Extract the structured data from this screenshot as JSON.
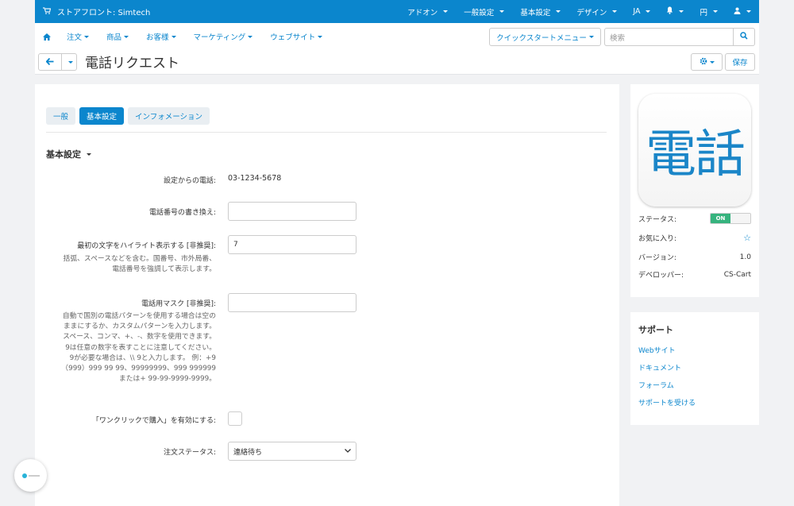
{
  "topbar": {
    "brand": "ストアフロント: Simtech",
    "menu": [
      {
        "label": "アドオン"
      },
      {
        "label": "一般設定"
      },
      {
        "label": "基本設定"
      },
      {
        "label": "デザイン"
      },
      {
        "label": "JA"
      },
      {
        "label": ""
      },
      {
        "label": "円"
      },
      {
        "label": ""
      }
    ]
  },
  "mainnav": {
    "items": [
      "注文",
      "商品",
      "お客様",
      "マーケティング",
      "ウェブサイト"
    ]
  },
  "quickstart": {
    "label": "クイックスタートメニュー"
  },
  "search": {
    "placeholder": "検索"
  },
  "page": {
    "title": "電話リクエスト",
    "save_label": "保存"
  },
  "tabs": [
    {
      "label": "一般",
      "active": false
    },
    {
      "label": "基本設定",
      "active": true
    },
    {
      "label": "インフォメーション",
      "active": false
    }
  ],
  "section": {
    "title": "基本設定"
  },
  "form": {
    "phone_from_settings": {
      "label": "設定からの電話:",
      "value": "03-1234-5678"
    },
    "phone_override": {
      "label": "電話番号の書き換え:",
      "value": ""
    },
    "highlight_first": {
      "label": "最初の文字をハイライト表示する [非推奨]:",
      "value": "7",
      "help": [
        "括弧、スペースなどを含む。国番号、市外局番、",
        "電話番号を強調して表示します。"
      ]
    },
    "phone_mask": {
      "label": "電話用マスク [非推奨]:",
      "value": "",
      "help": [
        "自動で国別の電話パターンを使用する場合は空の",
        "ままにするか、カスタムパターンを入力します。",
        "スペース、コンマ、+、-、数字を使用できます。",
        "9は任意の数字を表すことに注意してください。",
        "9が必要な場合は、\\\\ 9と入力します。 例：+9",
        "（999）999 99 99、99999999、999 999999",
        "または+ 99-99-9999-9999。"
      ]
    },
    "one_click": {
      "label": "「ワンクリックで購入」を有効にする:",
      "checked": false
    },
    "order_status": {
      "label": "注文ステータス:",
      "value": "連絡待ち"
    }
  },
  "addon": {
    "icon_text": "電話",
    "status_label": "ステータス:",
    "status_value": "ON",
    "favorite_label": "お気に入り:",
    "version_label": "バージョン:",
    "version_value": "1.0",
    "developer_label": "デベロッパー:",
    "developer_value": "CS-Cart"
  },
  "support": {
    "title": "サポート",
    "links": [
      "Webサイト",
      "ドキュメント",
      "フォーラム",
      "サポートを受ける"
    ]
  },
  "colors": {
    "accent": "#0b86cd",
    "status_on": "#36b37e"
  }
}
